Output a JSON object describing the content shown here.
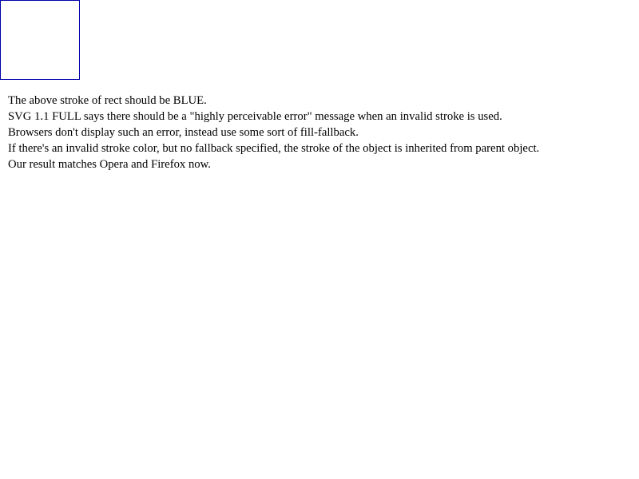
{
  "test_rect": {
    "stroke_color": "#0000aa",
    "fill_color": "#ffffff"
  },
  "notes": [
    "The above stroke of rect should be BLUE.",
    "SVG 1.1 FULL says there should be a \"highly perceivable error\" message when an invalid stroke is used.",
    "Browsers don't display such an error, instead use some sort of fill-fallback.",
    "If there's an invalid stroke color, but no fallback specified, the stroke of the object is inherited from parent object.",
    "Our result matches Opera and Firefox now."
  ]
}
